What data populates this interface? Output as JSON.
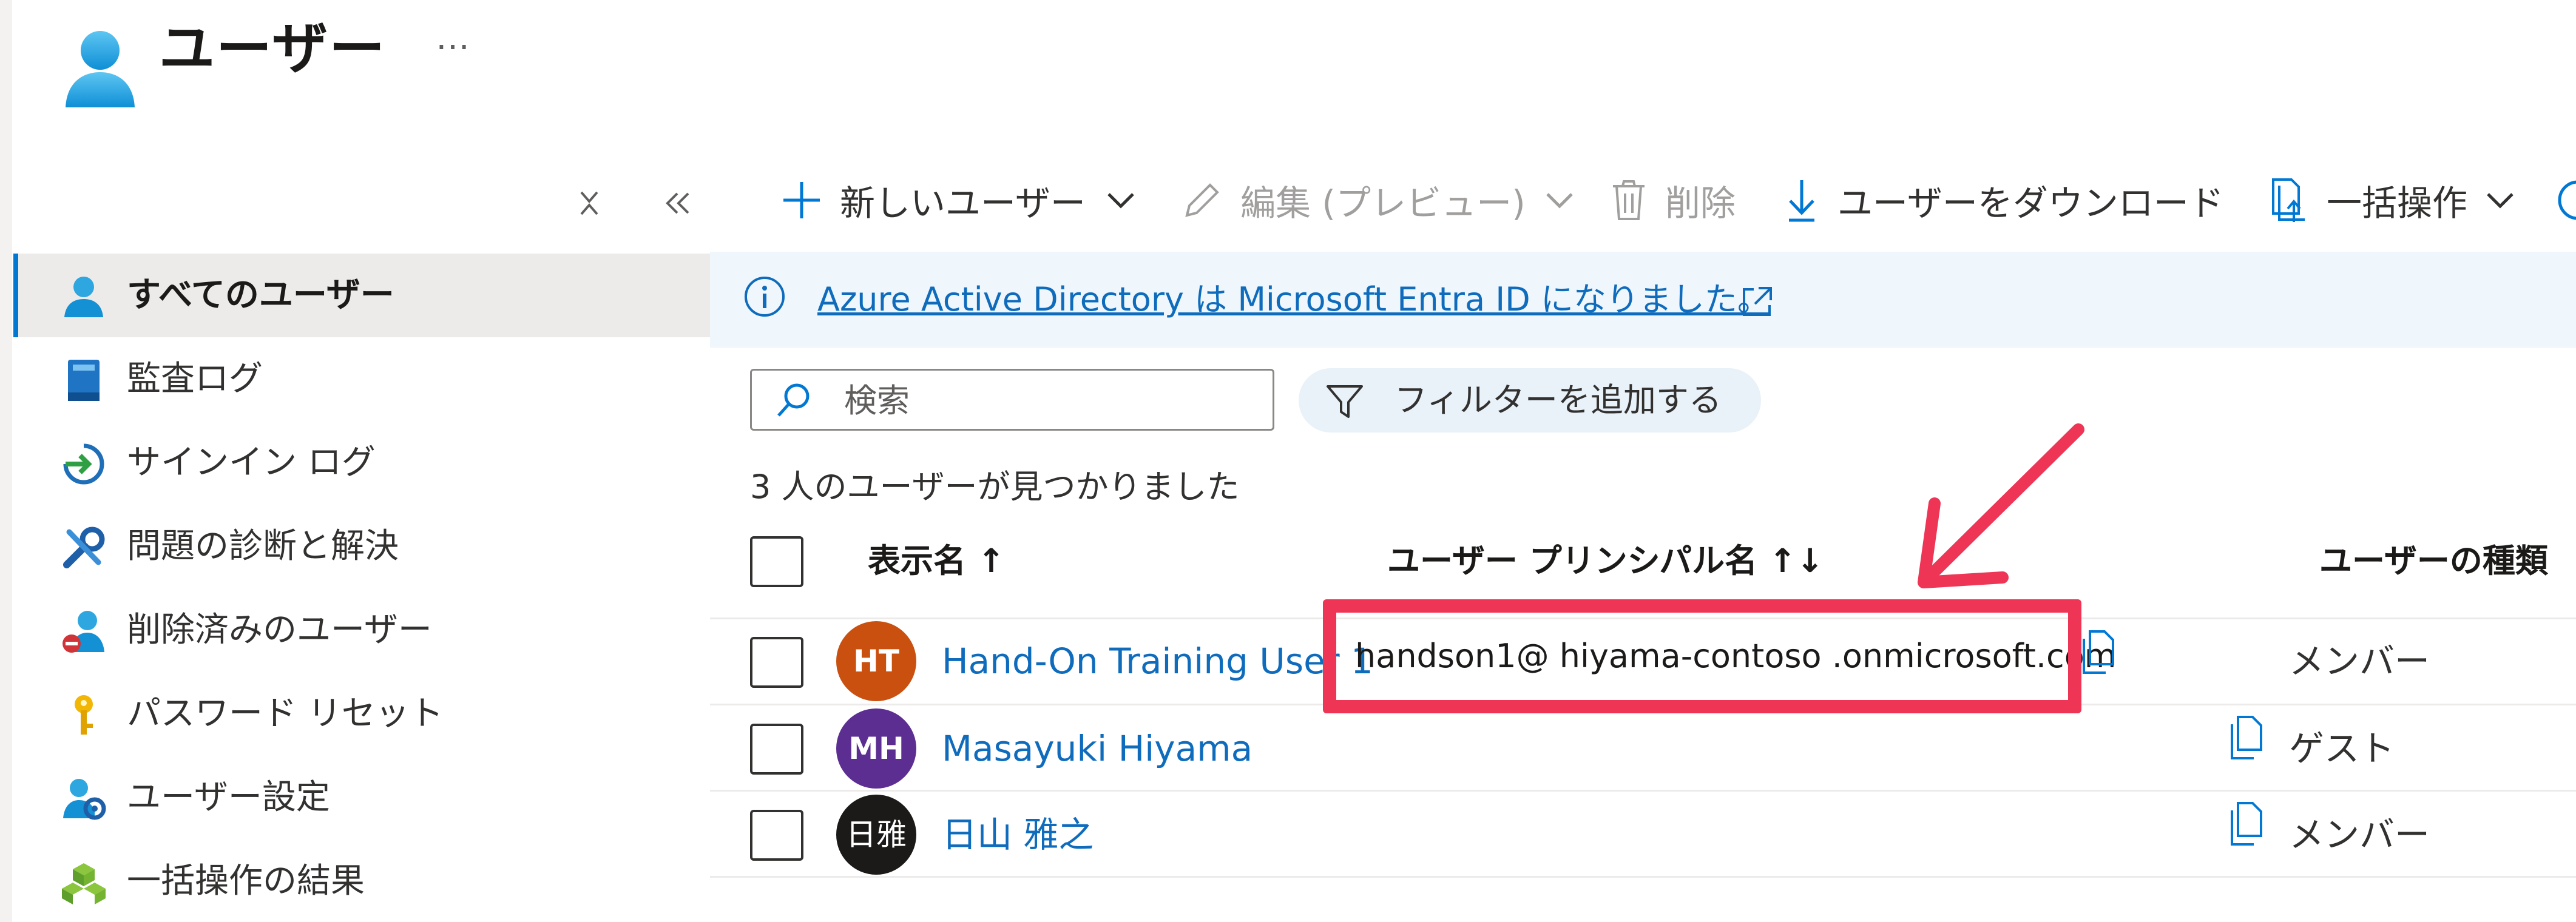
{
  "header": {
    "title": "ユーザー",
    "more_label": "…"
  },
  "sidebar": {
    "items": [
      {
        "label": "すべてのユーザー",
        "icon": "user-icon",
        "active": true
      },
      {
        "label": "監査ログ",
        "icon": "audit-log-icon"
      },
      {
        "label": "サインイン ログ",
        "icon": "sign-in-icon"
      },
      {
        "label": "問題の診断と解決",
        "icon": "wrench-icon"
      },
      {
        "label": "削除済みのユーザー",
        "icon": "deleted-user-icon"
      },
      {
        "label": "パスワード リセット",
        "icon": "key-icon"
      },
      {
        "label": "ユーザー設定",
        "icon": "user-settings-icon"
      },
      {
        "label": "一括操作の結果",
        "icon": "bulk-results-icon"
      }
    ]
  },
  "toolbar": {
    "new_user": "新しいユーザー",
    "edit": "編集 (プレビュー)",
    "delete": "削除",
    "download": "ユーザーをダウンロード",
    "bulk": "一括操作"
  },
  "banner": {
    "text": "Azure Active Directory は Microsoft Entra ID になりました。"
  },
  "search": {
    "placeholder": "検索"
  },
  "filter": {
    "label": "フィルターを追加する"
  },
  "result_count": "3 人のユーザーが見つかりました",
  "table": {
    "columns": {
      "display_name": "表示名 ↑",
      "upn": "ユーザー プリンシパル名 ↑↓",
      "user_type": "ユーザーの種類"
    },
    "rows": [
      {
        "initials": "HT",
        "avatar_color": "#ca5010",
        "name": "Hand-On Training User 1",
        "upn": "handson1@ hiyama-contoso .onmicrosoft.com",
        "type": "メンバー"
      },
      {
        "initials": "MH",
        "avatar_color": "#5c2e91",
        "name": "Masayuki Hiyama",
        "upn": "",
        "type": "ゲスト"
      },
      {
        "initials": "日雅",
        "avatar_color": "#1b1a19",
        "name": "日山 雅之",
        "upn": "",
        "type": "メンバー"
      }
    ]
  },
  "colors": {
    "accent": "#0078d4",
    "link": "#0f6cbd",
    "annotation": "#ef3555"
  }
}
